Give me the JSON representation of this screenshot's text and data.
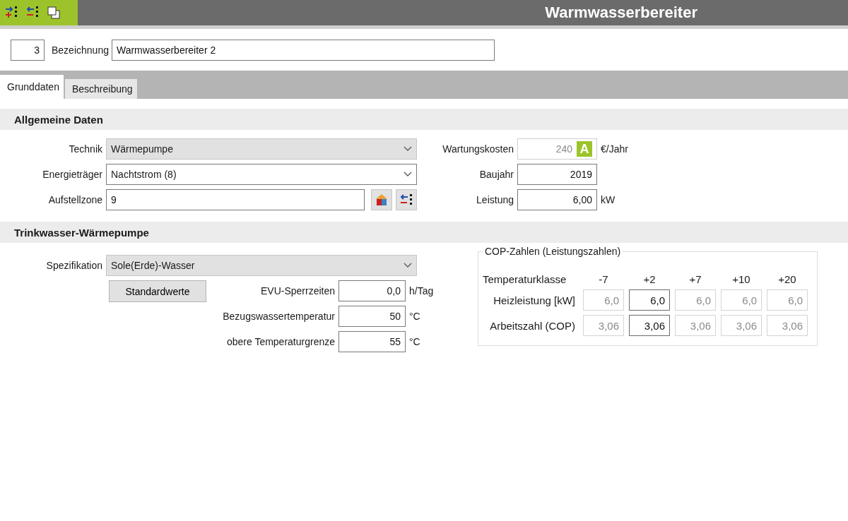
{
  "window": {
    "title": "Warmwasserbereiter"
  },
  "header": {
    "number": "3",
    "name_label": "Bezeichnung",
    "name_value": "Warmwasserbereiter 2"
  },
  "tabs": [
    {
      "label": "Grunddaten",
      "selected": true
    },
    {
      "label": "Beschreibung",
      "selected": false
    }
  ],
  "general": {
    "title": "Allgemeine Daten",
    "left_fields": [
      {
        "label": "Technik",
        "value": "Wärmepumpe",
        "kind": "select",
        "disabled": true
      },
      {
        "label": "Energieträger",
        "value": "Nachtstrom (8)",
        "kind": "select",
        "disabled": false
      },
      {
        "label": "Aufstellzone",
        "value": "9",
        "kind": "zone",
        "disabled": false
      }
    ],
    "right_fields": [
      {
        "label": "Wartungskosten",
        "value": "240",
        "badge": "A",
        "unit": "€/Jahr",
        "disabled": true
      },
      {
        "label": "Baujahr",
        "value": "2019",
        "disabled": false
      },
      {
        "label": "Leistung",
        "value": "6,00",
        "unit": "kW",
        "disabled": false
      }
    ]
  },
  "heat_pump": {
    "title": "Trinkwasser-Wärmepumpe",
    "spec": {
      "label": "Spezifikation",
      "value": "Sole(Erde)-Wasser",
      "disabled": true
    },
    "button": "Standardwerte",
    "fields": [
      {
        "label": "EVU-Sperrzeiten",
        "value": "0,0",
        "unit": "h/Tag"
      },
      {
        "label": "Bezugswassertemperatur",
        "value": "50",
        "unit": "°C"
      },
      {
        "label": "obere Temperaturgrenze",
        "value": "55",
        "unit": "°C"
      }
    ],
    "cop": {
      "title": "COP-Zahlen (Leistungszahlen)",
      "header_label": "Temperaturklasse",
      "columns": [
        "-7",
        "+2",
        "+7",
        "+10",
        "+20"
      ],
      "rows": [
        {
          "label": "Heizleistung [kW]",
          "cells": [
            {
              "value": "6,0",
              "disabled": true
            },
            {
              "value": "6,0",
              "disabled": false
            },
            {
              "value": "6,0",
              "disabled": true
            },
            {
              "value": "6,0",
              "disabled": true
            },
            {
              "value": "6,0",
              "disabled": true
            }
          ]
        },
        {
          "label": "Arbeitszahl (COP)",
          "cells": [
            {
              "value": "3,06",
              "disabled": true
            },
            {
              "value": "3,06",
              "disabled": false
            },
            {
              "value": "3,06",
              "disabled": true
            },
            {
              "value": "3,06",
              "disabled": true
            },
            {
              "value": "3,06",
              "disabled": true
            }
          ]
        }
      ]
    }
  }
}
